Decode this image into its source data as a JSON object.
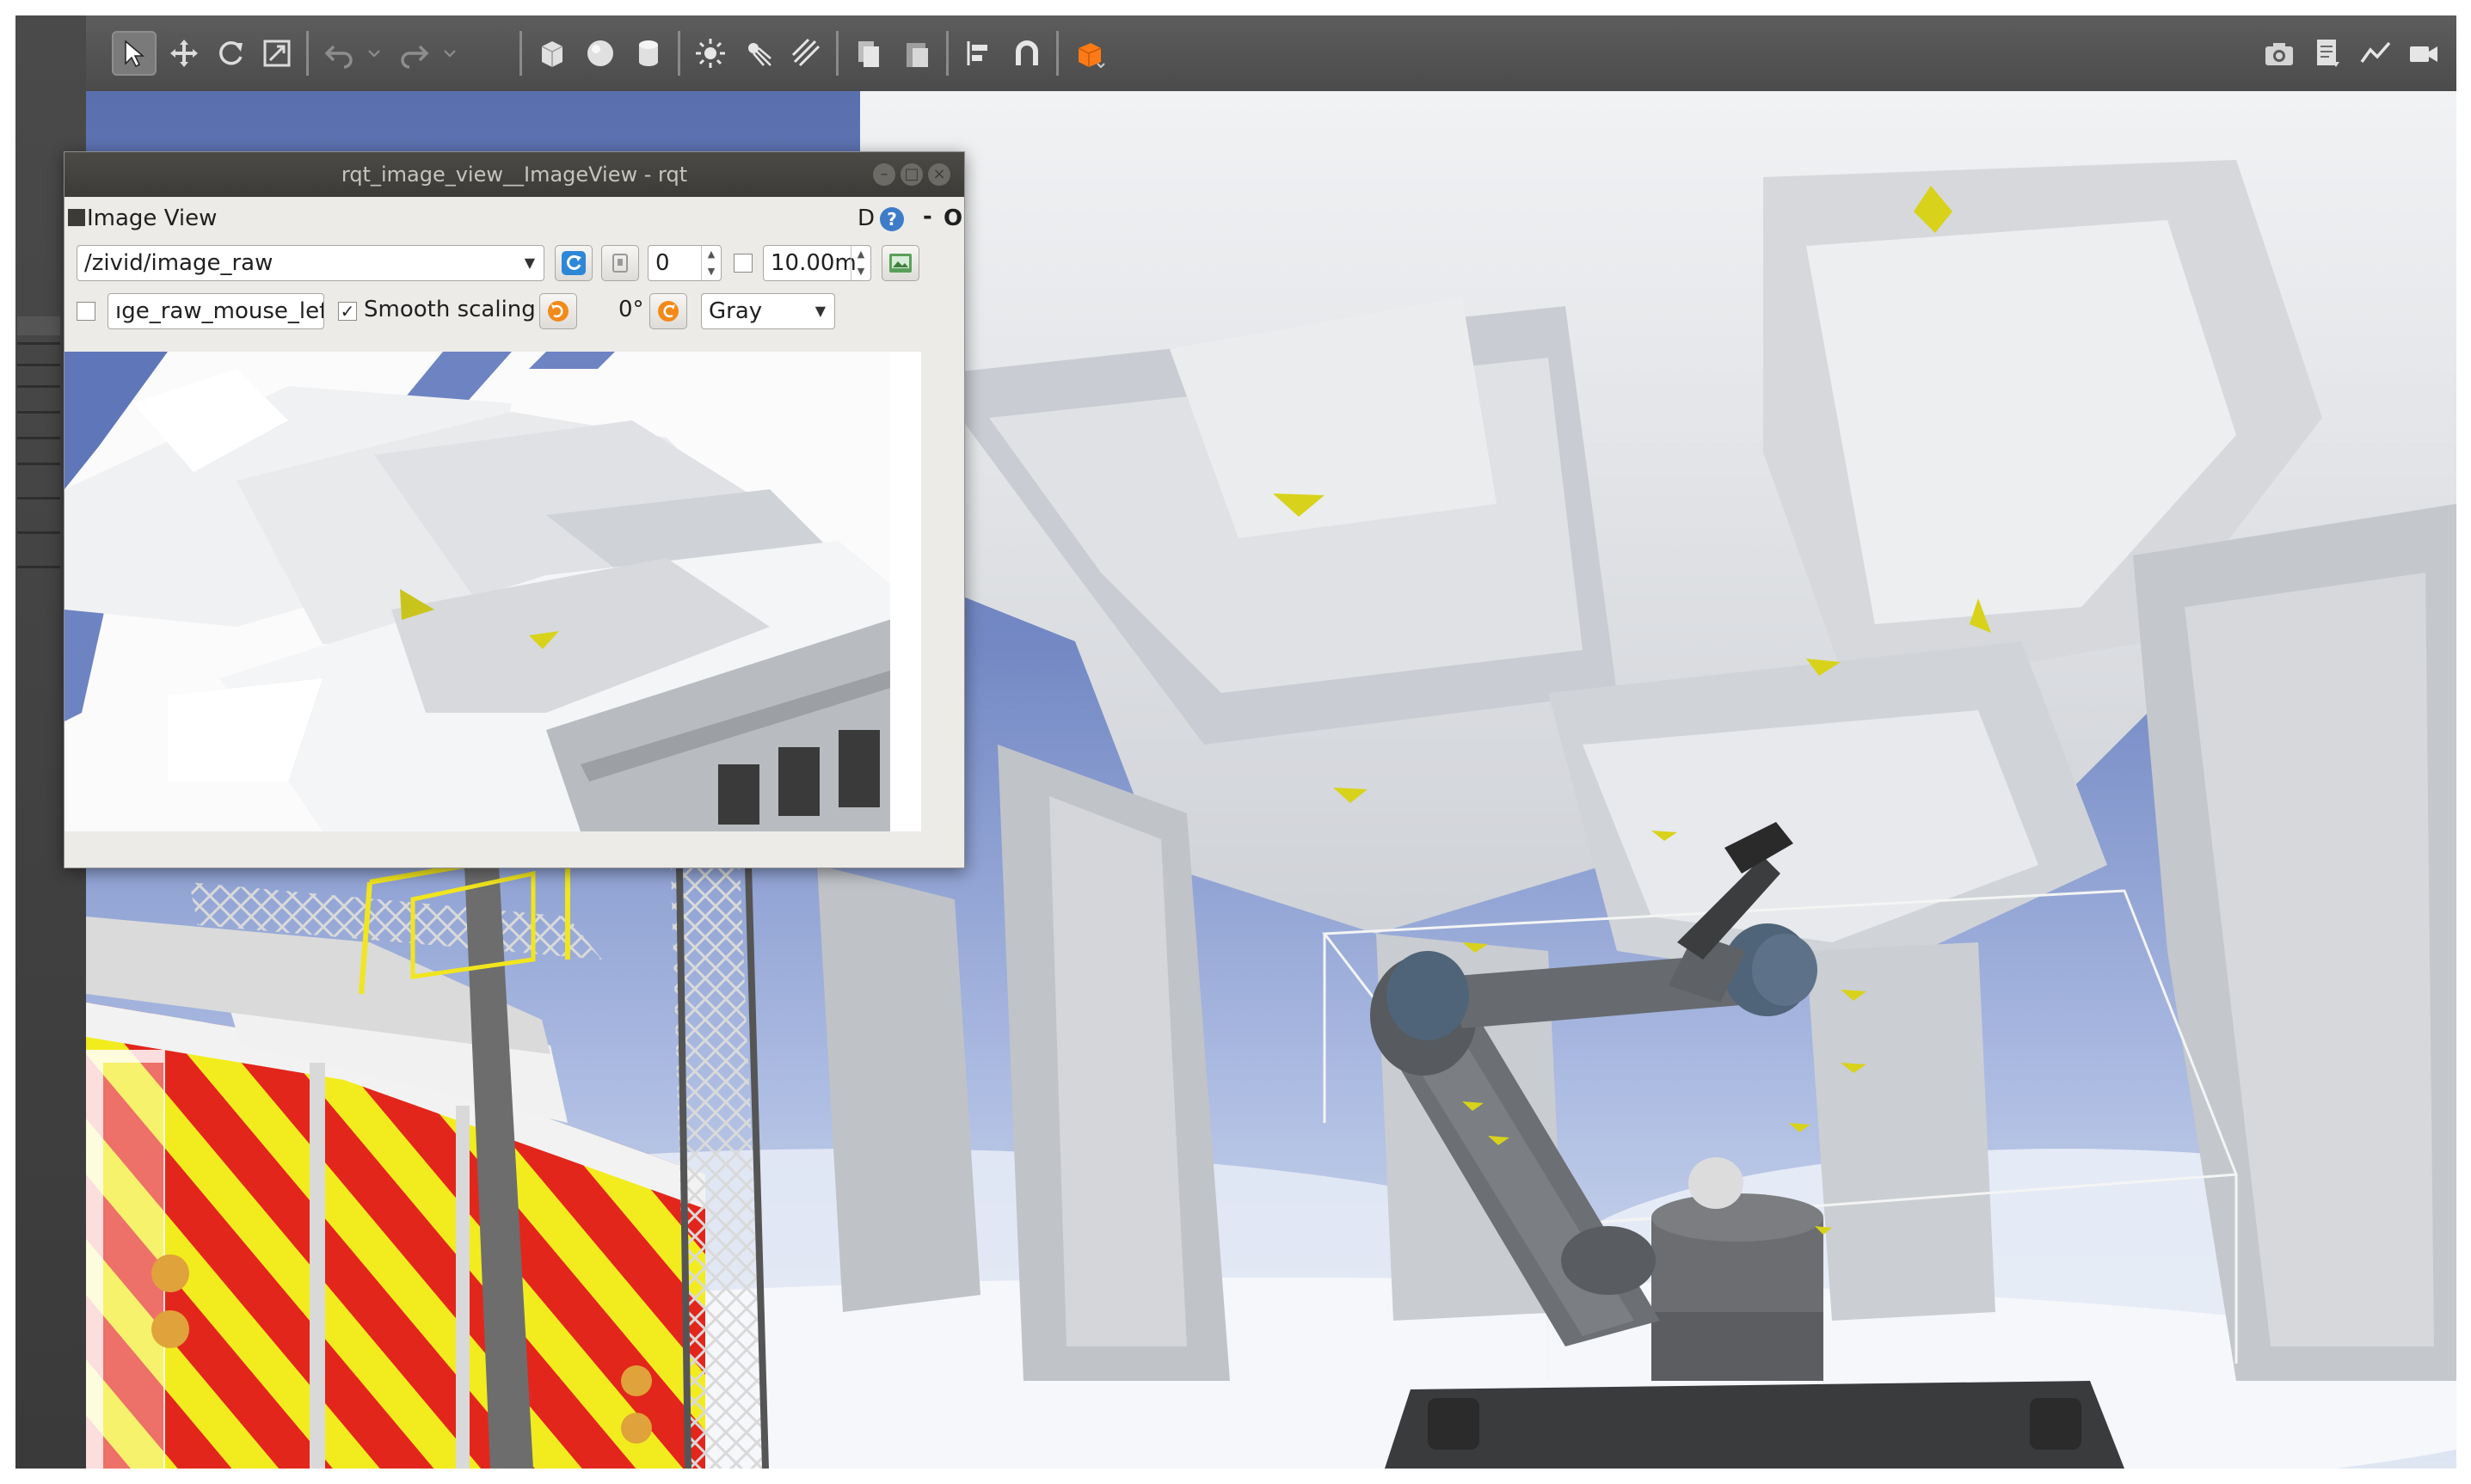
{
  "rqt_window": {
    "title": "rqt_image_view__ImageView - rqt",
    "plugin_title": "Image View",
    "help_d": "D",
    "help_q": "?",
    "header_min": "-",
    "header_close": "O",
    "topic": "/zivid/image_raw",
    "zoom_value": "0",
    "max_depth": "10.00m",
    "mouse_topic": "ıge_raw_mouse_left",
    "smooth_scaling_label": "Smooth scaling",
    "smooth_scaling_checked": "✓",
    "rotation": "0°",
    "color_scheme": "Gray"
  },
  "toolbar_icons": [
    "select-icon",
    "move-icon",
    "rotate-icon",
    "scale-icon",
    "undo-icon",
    "redo-icon",
    "box-icon",
    "sphere-icon",
    "cylinder-icon",
    "sun-icon",
    "spotlight-icon",
    "directional-light-icon",
    "copy-icon",
    "paste-icon",
    "align-icon",
    "magnet-icon",
    "view-angle-icon",
    "screenshot-icon",
    "log-icon",
    "plot-icon",
    "video-icon"
  ],
  "colors": {
    "sky": "#7388c4",
    "mesh": "#e4e6ea",
    "truck_red": "#e3261c",
    "truck_yellow": "#f2ec1f",
    "marker_yellow": "#d8d21a",
    "robot_gray": "#5f6366",
    "joint_blue": "#4f6478"
  }
}
